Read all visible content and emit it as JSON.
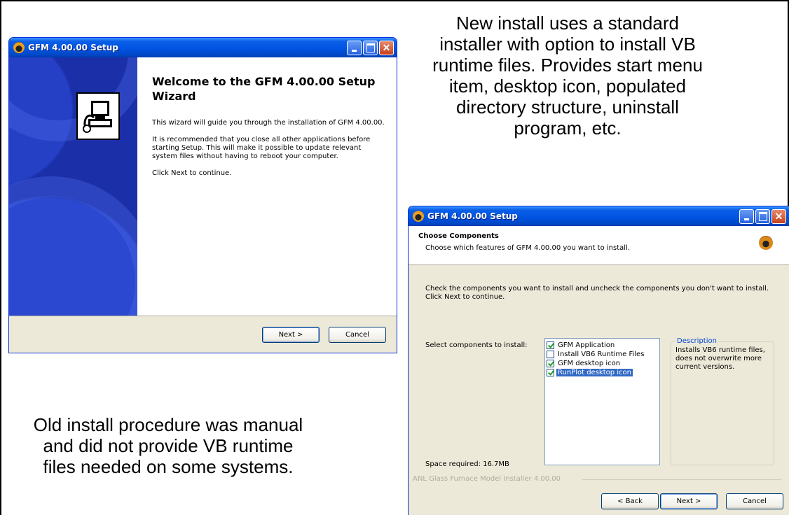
{
  "captions": {
    "top": "New install uses a standard installer with option to install VB runtime files. Provides start menu item, desktop icon, populated directory structure, uninstall program, etc.",
    "bottom": "Old install procedure was manual and did not provide VB runtime files needed on some systems."
  },
  "welcome_window": {
    "title": "GFM 4.00.00 Setup",
    "heading": "Welcome to the GFM 4.00.00 Setup Wizard",
    "paragraphs": [
      "This wizard will guide you through the installation of GFM 4.00.00.",
      "It is recommended that you close all other applications before starting Setup. This will make it possible to update relevant system files without having to reboot your computer.",
      "Click Next to continue."
    ],
    "next_label": "Next >",
    "cancel_label": "Cancel"
  },
  "components_window": {
    "title": "GFM 4.00.00 Setup",
    "header_title": "Choose Components",
    "header_subtitle": "Choose which features of GFM 4.00.00 you want to install.",
    "intro": "Check the components you want to install and uncheck the components you don't want to install. Click Next to continue.",
    "select_label": "Select components to install:",
    "components": [
      {
        "label": "GFM Application",
        "checked": true,
        "selected": false
      },
      {
        "label": "Install VB6 Runtime Files",
        "checked": false,
        "selected": false
      },
      {
        "label": "GFM desktop icon",
        "checked": true,
        "selected": false
      },
      {
        "label": "RunPlot desktop icon",
        "checked": true,
        "selected": true
      }
    ],
    "description_title": "Description",
    "description_text": "Installs VB6 runtime files, does not overwrite more current versions.",
    "space_required": "Space required: 16.7MB",
    "brand_text": "ANL Glass Furnace Model Installer 4.00.00",
    "back_label": "< Back",
    "next_label": "Next >",
    "cancel_label": "Cancel"
  },
  "colors": {
    "titlebar": "#0054e3",
    "dialog_bg": "#ece9d8",
    "sidebar": "#1a2fa8",
    "selection": "#316ac5"
  }
}
